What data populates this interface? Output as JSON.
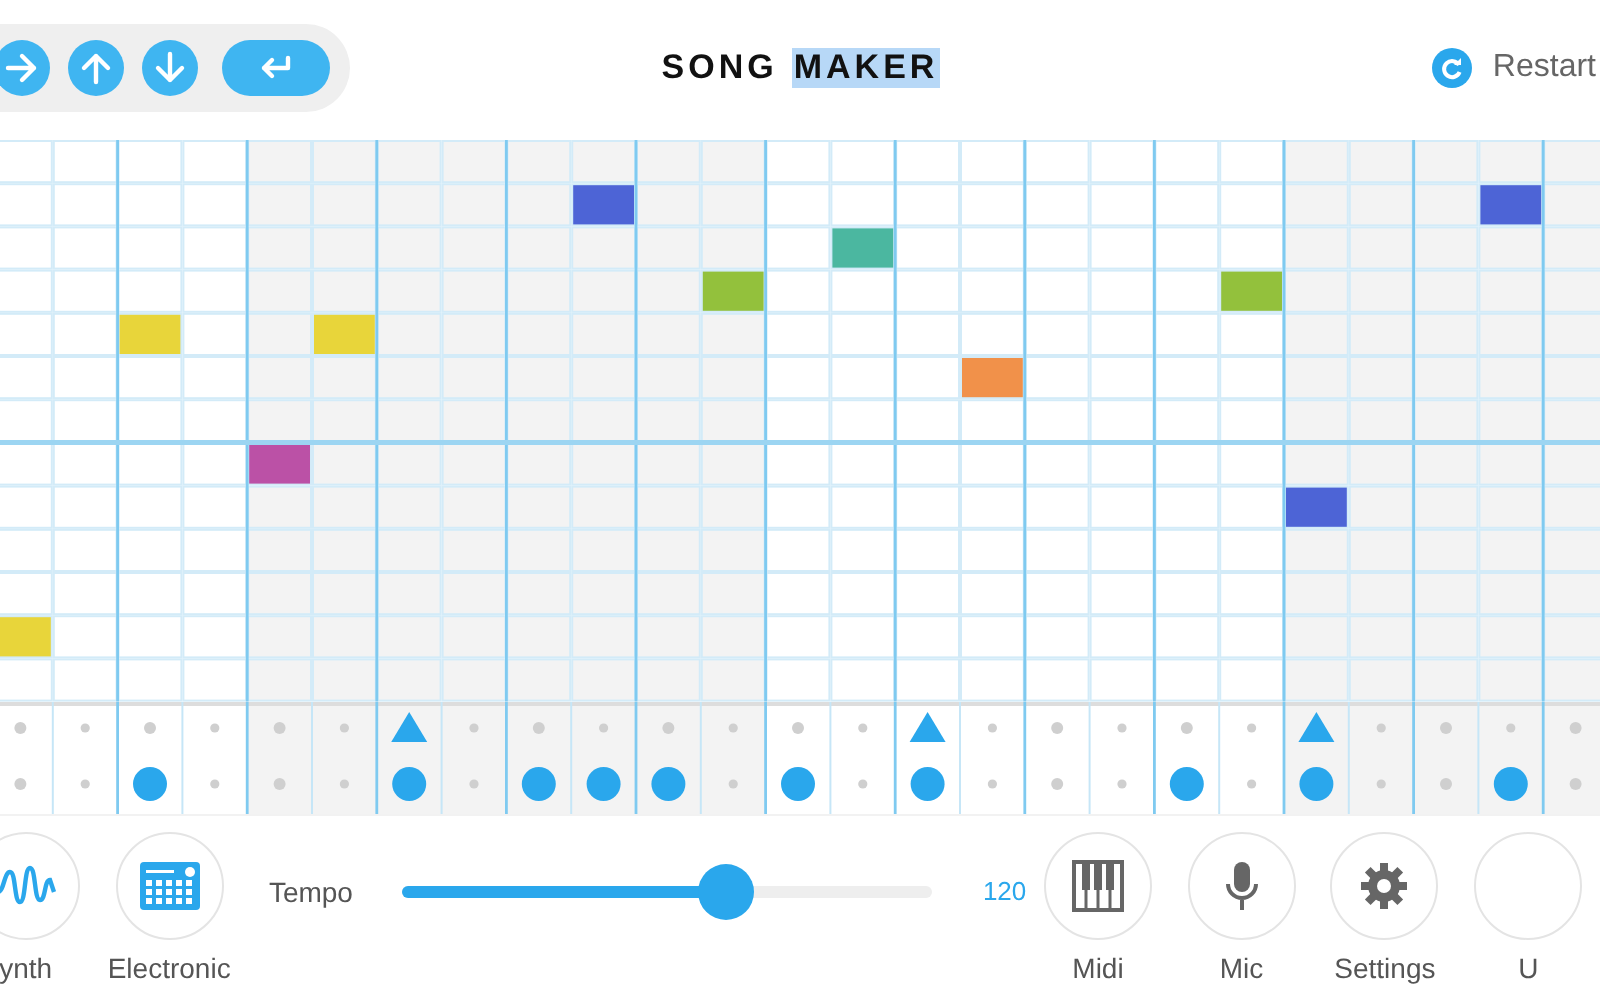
{
  "toolbar": {
    "buttons": [
      {
        "kind": "right"
      },
      {
        "kind": "up"
      },
      {
        "kind": "down"
      },
      {
        "kind": "enter"
      }
    ]
  },
  "title": {
    "parts": [
      {
        "text": "SONG",
        "selected": false
      },
      {
        "text": "MAKER",
        "selected": true
      }
    ]
  },
  "restart": {
    "label": "Restart"
  },
  "melody": {
    "rows": [
      {
        "cells": [
          {
            "on": false
          },
          {
            "on": false
          },
          {
            "on": false
          },
          {
            "on": false
          },
          {
            "on": false
          },
          {
            "on": false
          },
          {
            "on": false
          },
          {
            "on": false
          },
          {
            "on": false
          },
          {
            "on": false
          },
          {
            "on": false
          },
          {
            "on": false
          },
          {
            "on": false
          },
          {
            "on": false
          },
          {
            "on": false
          },
          {
            "on": false
          },
          {
            "on": false
          },
          {
            "on": false
          },
          {
            "on": false
          },
          {
            "on": false
          },
          {
            "on": false
          },
          {
            "on": false
          },
          {
            "on": false
          },
          {
            "on": false
          },
          {
            "on": false
          }
        ]
      },
      {
        "cells": [
          {
            "on": false
          },
          {
            "on": false
          },
          {
            "on": false
          },
          {
            "on": false
          },
          {
            "on": false
          },
          {
            "on": false
          },
          {
            "on": false
          },
          {
            "on": false
          },
          {
            "on": false
          },
          {
            "on": true,
            "color": "#4d64d6"
          },
          {
            "on": false
          },
          {
            "on": false
          },
          {
            "on": false
          },
          {
            "on": false
          },
          {
            "on": false
          },
          {
            "on": false
          },
          {
            "on": false
          },
          {
            "on": false
          },
          {
            "on": false
          },
          {
            "on": false
          },
          {
            "on": false
          },
          {
            "on": false
          },
          {
            "on": false
          },
          {
            "on": true,
            "color": "#4d64d6"
          },
          {
            "on": false
          }
        ]
      },
      {
        "cells": [
          {
            "on": false
          },
          {
            "on": false
          },
          {
            "on": false
          },
          {
            "on": false
          },
          {
            "on": false
          },
          {
            "on": false
          },
          {
            "on": false
          },
          {
            "on": false
          },
          {
            "on": false
          },
          {
            "on": false
          },
          {
            "on": false
          },
          {
            "on": false
          },
          {
            "on": false
          },
          {
            "on": true,
            "color": "#4bb7a0"
          },
          {
            "on": false
          },
          {
            "on": false
          },
          {
            "on": false
          },
          {
            "on": false
          },
          {
            "on": false
          },
          {
            "on": false
          },
          {
            "on": false
          },
          {
            "on": false
          },
          {
            "on": false
          },
          {
            "on": false
          },
          {
            "on": false
          }
        ]
      },
      {
        "cells": [
          {
            "on": false
          },
          {
            "on": false
          },
          {
            "on": false
          },
          {
            "on": false
          },
          {
            "on": false
          },
          {
            "on": false
          },
          {
            "on": false
          },
          {
            "on": false
          },
          {
            "on": false
          },
          {
            "on": false
          },
          {
            "on": false
          },
          {
            "on": true,
            "color": "#93c13c"
          },
          {
            "on": false
          },
          {
            "on": false
          },
          {
            "on": false
          },
          {
            "on": false
          },
          {
            "on": false
          },
          {
            "on": false
          },
          {
            "on": false
          },
          {
            "on": true,
            "color": "#93c13c"
          },
          {
            "on": false
          },
          {
            "on": false
          },
          {
            "on": false
          },
          {
            "on": false
          },
          {
            "on": false
          }
        ]
      },
      {
        "cells": [
          {
            "on": false
          },
          {
            "on": false
          },
          {
            "on": true,
            "color": "#e8d53a"
          },
          {
            "on": false
          },
          {
            "on": false
          },
          {
            "on": true,
            "color": "#e8d53a"
          },
          {
            "on": false
          },
          {
            "on": false
          },
          {
            "on": false
          },
          {
            "on": false
          },
          {
            "on": false
          },
          {
            "on": false
          },
          {
            "on": false
          },
          {
            "on": false
          },
          {
            "on": false
          },
          {
            "on": false
          },
          {
            "on": false
          },
          {
            "on": false
          },
          {
            "on": false
          },
          {
            "on": false
          },
          {
            "on": false
          },
          {
            "on": false
          },
          {
            "on": false
          },
          {
            "on": false
          },
          {
            "on": false
          }
        ]
      },
      {
        "cells": [
          {
            "on": false
          },
          {
            "on": false
          },
          {
            "on": false
          },
          {
            "on": false
          },
          {
            "on": false
          },
          {
            "on": false
          },
          {
            "on": false
          },
          {
            "on": false
          },
          {
            "on": false
          },
          {
            "on": false
          },
          {
            "on": false
          },
          {
            "on": false
          },
          {
            "on": false
          },
          {
            "on": false
          },
          {
            "on": false
          },
          {
            "on": true,
            "color": "#f1914a"
          },
          {
            "on": false
          },
          {
            "on": false
          },
          {
            "on": false
          },
          {
            "on": false
          },
          {
            "on": false
          },
          {
            "on": false
          },
          {
            "on": false
          },
          {
            "on": false
          },
          {
            "on": false
          }
        ]
      },
      {
        "cells": [
          {
            "on": false
          },
          {
            "on": false
          },
          {
            "on": false
          },
          {
            "on": false
          },
          {
            "on": false
          },
          {
            "on": false
          },
          {
            "on": false
          },
          {
            "on": false
          },
          {
            "on": false
          },
          {
            "on": false
          },
          {
            "on": false
          },
          {
            "on": false
          },
          {
            "on": false
          },
          {
            "on": false
          },
          {
            "on": false
          },
          {
            "on": false
          },
          {
            "on": false
          },
          {
            "on": false
          },
          {
            "on": false
          },
          {
            "on": false
          },
          {
            "on": false
          },
          {
            "on": false
          },
          {
            "on": false
          },
          {
            "on": false
          },
          {
            "on": false
          }
        ]
      },
      {
        "cells": [
          {
            "on": false
          },
          {
            "on": false
          },
          {
            "on": false
          },
          {
            "on": false
          },
          {
            "on": true,
            "color": "#bb51a6"
          },
          {
            "on": false
          },
          {
            "on": false
          },
          {
            "on": false
          },
          {
            "on": false
          },
          {
            "on": false
          },
          {
            "on": false
          },
          {
            "on": false
          },
          {
            "on": false
          },
          {
            "on": false
          },
          {
            "on": false
          },
          {
            "on": false
          },
          {
            "on": false
          },
          {
            "on": false
          },
          {
            "on": false
          },
          {
            "on": false
          },
          {
            "on": false
          },
          {
            "on": false
          },
          {
            "on": false
          },
          {
            "on": false
          },
          {
            "on": false
          }
        ]
      },
      {
        "cells": [
          {
            "on": false
          },
          {
            "on": false
          },
          {
            "on": false
          },
          {
            "on": false
          },
          {
            "on": false
          },
          {
            "on": false
          },
          {
            "on": false
          },
          {
            "on": false
          },
          {
            "on": false
          },
          {
            "on": false
          },
          {
            "on": false
          },
          {
            "on": false
          },
          {
            "on": false
          },
          {
            "on": false
          },
          {
            "on": false
          },
          {
            "on": false
          },
          {
            "on": false
          },
          {
            "on": false
          },
          {
            "on": false
          },
          {
            "on": false
          },
          {
            "on": true,
            "color": "#4d64d6"
          },
          {
            "on": false
          },
          {
            "on": false
          },
          {
            "on": false
          },
          {
            "on": false
          }
        ]
      },
      {
        "cells": [
          {
            "on": false
          },
          {
            "on": false
          },
          {
            "on": false
          },
          {
            "on": false
          },
          {
            "on": false
          },
          {
            "on": false
          },
          {
            "on": false
          },
          {
            "on": false
          },
          {
            "on": false
          },
          {
            "on": false
          },
          {
            "on": false
          },
          {
            "on": false
          },
          {
            "on": false
          },
          {
            "on": false
          },
          {
            "on": false
          },
          {
            "on": false
          },
          {
            "on": false
          },
          {
            "on": false
          },
          {
            "on": false
          },
          {
            "on": false
          },
          {
            "on": false
          },
          {
            "on": false
          },
          {
            "on": false
          },
          {
            "on": false
          },
          {
            "on": false
          }
        ]
      },
      {
        "cells": [
          {
            "on": false
          },
          {
            "on": false
          },
          {
            "on": false
          },
          {
            "on": false
          },
          {
            "on": false
          },
          {
            "on": false
          },
          {
            "on": false
          },
          {
            "on": false
          },
          {
            "on": false
          },
          {
            "on": false
          },
          {
            "on": false
          },
          {
            "on": false
          },
          {
            "on": false
          },
          {
            "on": false
          },
          {
            "on": false
          },
          {
            "on": false
          },
          {
            "on": false
          },
          {
            "on": false
          },
          {
            "on": false
          },
          {
            "on": false
          },
          {
            "on": false
          },
          {
            "on": false
          },
          {
            "on": false
          },
          {
            "on": false
          },
          {
            "on": false
          }
        ]
      },
      {
        "cells": [
          {
            "on": true,
            "color": "#e8d53a"
          },
          {
            "on": false
          },
          {
            "on": false
          },
          {
            "on": false
          },
          {
            "on": false
          },
          {
            "on": false
          },
          {
            "on": false
          },
          {
            "on": false
          },
          {
            "on": false
          },
          {
            "on": false
          },
          {
            "on": false
          },
          {
            "on": false
          },
          {
            "on": false
          },
          {
            "on": false
          },
          {
            "on": false
          },
          {
            "on": false
          },
          {
            "on": false
          },
          {
            "on": false
          },
          {
            "on": false
          },
          {
            "on": false
          },
          {
            "on": false
          },
          {
            "on": false
          },
          {
            "on": false
          },
          {
            "on": false
          },
          {
            "on": false
          }
        ]
      },
      {
        "cells": [
          {
            "on": false
          },
          {
            "on": false
          },
          {
            "on": false
          },
          {
            "on": false
          },
          {
            "on": false
          },
          {
            "on": false
          },
          {
            "on": false
          },
          {
            "on": false
          },
          {
            "on": false
          },
          {
            "on": false
          },
          {
            "on": false
          },
          {
            "on": false
          },
          {
            "on": false
          },
          {
            "on": false
          },
          {
            "on": false
          },
          {
            "on": false
          },
          {
            "on": false
          },
          {
            "on": false
          },
          {
            "on": false
          },
          {
            "on": false
          },
          {
            "on": false
          },
          {
            "on": false
          },
          {
            "on": false
          },
          {
            "on": false
          },
          {
            "on": false
          }
        ]
      }
    ]
  },
  "percussion": [
    {
      "kind": "triangle",
      "steps": [
        {
          "hit": false
        },
        {
          "hit": false
        },
        {
          "hit": false
        },
        {
          "hit": false
        },
        {
          "hit": false
        },
        {
          "hit": false
        },
        {
          "hit": true
        },
        {
          "hit": false
        },
        {
          "hit": false
        },
        {
          "hit": false
        },
        {
          "hit": false
        },
        {
          "hit": false
        },
        {
          "hit": false
        },
        {
          "hit": false
        },
        {
          "hit": true
        },
        {
          "hit": false
        },
        {
          "hit": false
        },
        {
          "hit": false
        },
        {
          "hit": false
        },
        {
          "hit": false
        },
        {
          "hit": true
        },
        {
          "hit": false
        },
        {
          "hit": false
        },
        {
          "hit": false
        },
        {
          "hit": false
        }
      ]
    },
    {
      "kind": "circle",
      "steps": [
        {
          "hit": false
        },
        {
          "hit": false
        },
        {
          "hit": true
        },
        {
          "hit": false
        },
        {
          "hit": false
        },
        {
          "hit": false
        },
        {
          "hit": true
        },
        {
          "hit": false
        },
        {
          "hit": true
        },
        {
          "hit": true
        },
        {
          "hit": true
        },
        {
          "hit": false
        },
        {
          "hit": true
        },
        {
          "hit": false
        },
        {
          "hit": true
        },
        {
          "hit": false
        },
        {
          "hit": false
        },
        {
          "hit": false
        },
        {
          "hit": true
        },
        {
          "hit": false
        },
        {
          "hit": true
        },
        {
          "hit": false
        },
        {
          "hit": false
        },
        {
          "hit": true
        },
        {
          "hit": false
        }
      ]
    }
  ],
  "instruments": [
    {
      "kind": "synth",
      "label": "ynth"
    },
    {
      "kind": "electronic",
      "label": "Electronic"
    }
  ],
  "tempo": {
    "label": "Tempo",
    "level": 0.61,
    "reading": "120"
  },
  "tools": [
    {
      "kind": "midi",
      "label": "Midi"
    },
    {
      "kind": "mic",
      "label": "Mic"
    },
    {
      "kind": "settings",
      "label": "Settings"
    },
    {
      "kind": "undo",
      "label": "U"
    }
  ]
}
